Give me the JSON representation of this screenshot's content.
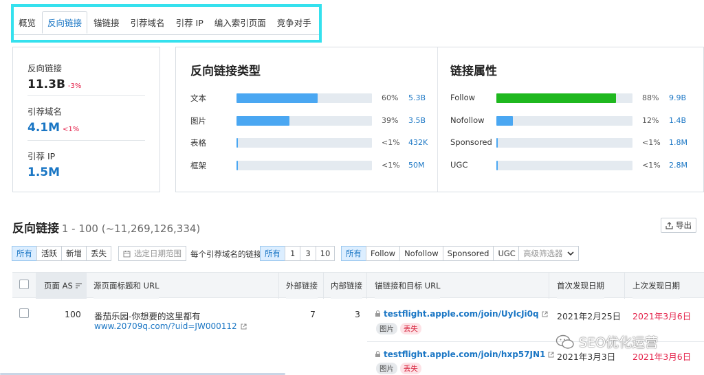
{
  "tabs": [
    "概览",
    "反向链接",
    "锚链接",
    "引荐域名",
    "引荐 IP",
    "编入索引页面",
    "竞争对手"
  ],
  "stats": [
    {
      "label": "反向链接",
      "value": "11.3B",
      "delta": "-3%",
      "value_color": "#222222"
    },
    {
      "label": "引荐域名",
      "value": "4.1M",
      "delta": "<1%",
      "value_color": "#1a76c4"
    },
    {
      "label": "引荐 IP",
      "value": "1.5M",
      "delta": "",
      "value_color": "#1a76c4"
    }
  ],
  "link_types": {
    "title": "反向链接类型",
    "rows": [
      {
        "label": "文本",
        "fill": 0.6,
        "pct": "60%",
        "value": "5.3B"
      },
      {
        "label": "图片",
        "fill": 0.39,
        "pct": "39%",
        "value": "3.5B"
      },
      {
        "label": "表格",
        "fill": 0.01,
        "pct": "<1%",
        "value": "432K"
      },
      {
        "label": "框架",
        "fill": 0.01,
        "pct": "<1%",
        "value": "50M"
      }
    ]
  },
  "link_attrs": {
    "title": "链接属性",
    "rows": [
      {
        "label": "Follow",
        "fill": 0.88,
        "pct": "88%",
        "value": "9.9B"
      },
      {
        "label": "Nofollow",
        "fill": 0.12,
        "pct": "12%",
        "value": "1.4B"
      },
      {
        "label": "Sponsored",
        "fill": 0.01,
        "pct": "<1%",
        "value": "1.8M"
      },
      {
        "label": "UGC",
        "fill": 0.01,
        "pct": "<1%",
        "value": "2.8M"
      }
    ]
  },
  "backlinks": {
    "title": "反向链接",
    "range": "1 - 100 (~11,269,126,334)",
    "export": "导出"
  },
  "filters": {
    "group1": [
      "所有",
      "活跃",
      "新增",
      "丢失"
    ],
    "date": "选定日期范围",
    "per_domain_label": "每个引荐域名的链接",
    "group2": [
      "所有",
      "1",
      "3",
      "10"
    ],
    "group3": [
      "所有",
      "Follow",
      "Nofollow",
      "Sponsored",
      "UGC"
    ],
    "advanced": "高级筛选器"
  },
  "table": {
    "headers": [
      "页面 AS",
      "源页面标题和 URL",
      "外部链接",
      "内部链接",
      "锚链接和目标 URL",
      "首次发现日期",
      "上次发现日期"
    ],
    "rows": [
      {
        "as": "100",
        "title": "番茄乐园-你想要的这里都有",
        "url": "www.20709q.com/?uid=JW000112",
        "ext": "7",
        "int": "3",
        "targets": [
          {
            "url": "testflight.apple.com/join/UyIcJi0q",
            "tags": [
              "图片",
              "丢失"
            ],
            "first": "2021年2月25日",
            "last": "2021年3月6日"
          },
          {
            "url": "testflight.apple.com/join/hxp57JN1",
            "tags": [
              "图片",
              "丢失"
            ],
            "first": "2021年3月3日",
            "last": "2021年3月6日"
          }
        ]
      }
    ]
  },
  "watermark": "SEO优化运营"
}
